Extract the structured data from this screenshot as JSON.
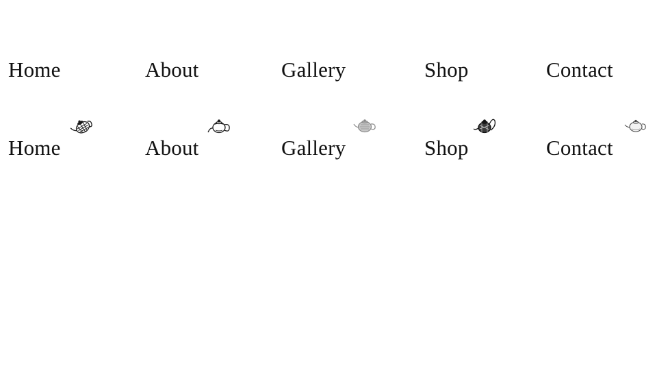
{
  "nav_plain": {
    "items": [
      {
        "label": "Home"
      },
      {
        "label": "About"
      },
      {
        "label": "Gallery"
      },
      {
        "label": "Shop"
      },
      {
        "label": "Contact"
      }
    ]
  },
  "nav_icons": {
    "items": [
      {
        "label": "Home",
        "icon": "teapot-icon",
        "icon_style": "hatched-tilted"
      },
      {
        "label": "About",
        "icon": "teapot-icon",
        "icon_style": "line-drawing"
      },
      {
        "label": "Gallery",
        "icon": "teapot-icon",
        "icon_style": "grey-shaded"
      },
      {
        "label": "Shop",
        "icon": "teapot-icon",
        "icon_style": "dark-engraved"
      },
      {
        "label": "Contact",
        "icon": "teapot-icon",
        "icon_style": "light-outline"
      }
    ]
  },
  "colors": {
    "background": "#ffffff",
    "text": "#111111",
    "icon_dark": "#1a1a1a",
    "icon_grey": "#9a9a9a"
  }
}
